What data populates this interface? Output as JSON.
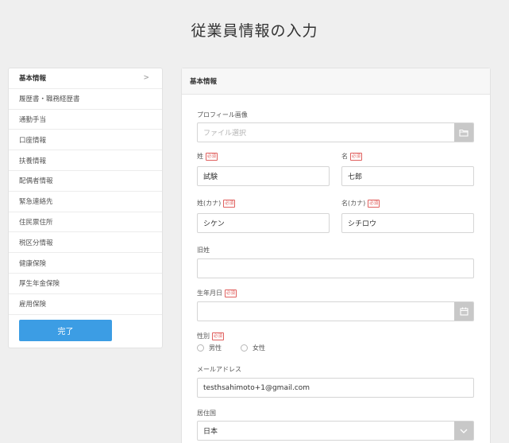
{
  "page": {
    "title": "従業員情報の入力"
  },
  "sidebar": {
    "items": [
      {
        "label": "基本情報",
        "active": true
      },
      {
        "label": "履歴書・職務経歴書"
      },
      {
        "label": "通勤手当"
      },
      {
        "label": "口座情報"
      },
      {
        "label": "扶養情報"
      },
      {
        "label": "配偶者情報"
      },
      {
        "label": "緊急連絡先"
      },
      {
        "label": "住民票住所"
      },
      {
        "label": "税区分情報"
      },
      {
        "label": "健康保険"
      },
      {
        "label": "厚生年金保険"
      },
      {
        "label": "雇用保険"
      }
    ],
    "chevron": ">",
    "done_label": "完了"
  },
  "panel": {
    "title": "基本情報",
    "required_badge": "必須",
    "profile_image": {
      "label": "プロフィール画像",
      "placeholder": "ファイル選択",
      "icon": "folder-icon"
    },
    "last_name": {
      "label": "姓",
      "value": "試験"
    },
    "first_name": {
      "label": "名",
      "value": "七郎"
    },
    "last_name_kana": {
      "label": "姓(カナ)",
      "value": "シケン"
    },
    "first_name_kana": {
      "label": "名(カナ)",
      "value": "シチロウ"
    },
    "maiden_name": {
      "label": "旧姓",
      "value": ""
    },
    "birthdate": {
      "label": "生年月日",
      "value": "",
      "icon": "calendar-icon"
    },
    "gender": {
      "label": "性別",
      "options": [
        "男性",
        "女性"
      ]
    },
    "email": {
      "label": "メールアドレス",
      "value": "testhsahimoto+1@gmail.com"
    },
    "country": {
      "label": "居住国",
      "value": "日本",
      "icon": "chevron-down-icon"
    }
  }
}
